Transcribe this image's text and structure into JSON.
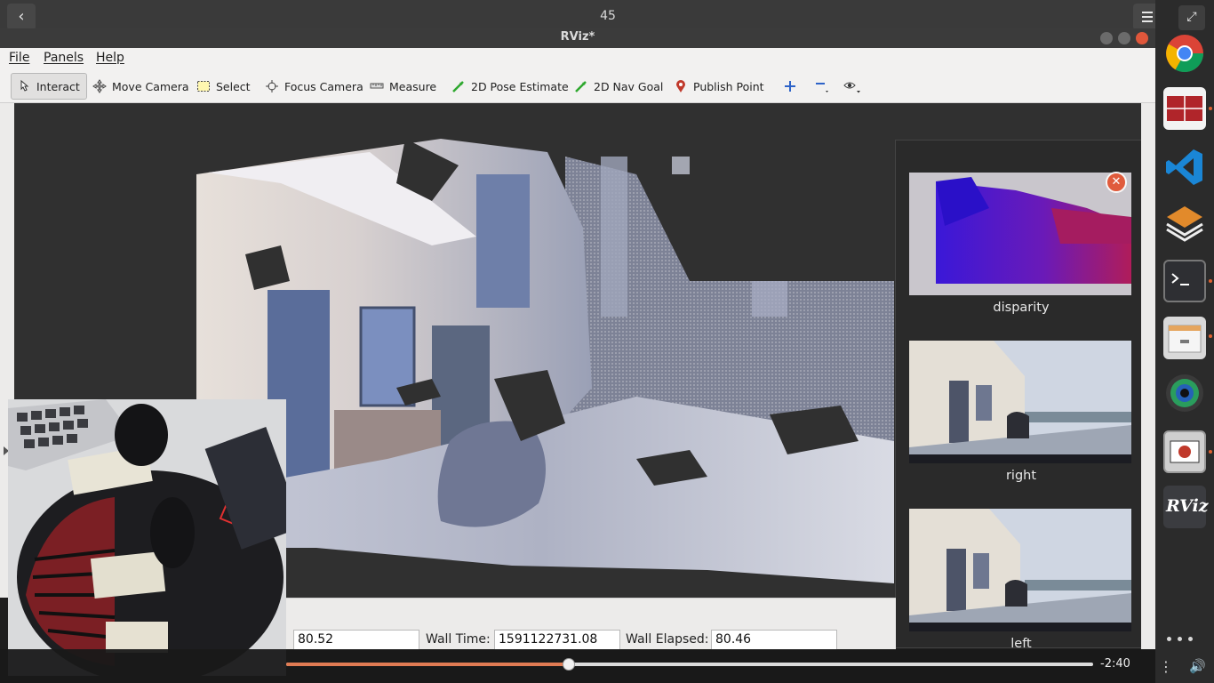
{
  "player": {
    "title": "45",
    "back_icon": "‹",
    "menu_icon": "hamburger-menu",
    "seek_fraction": 0.35,
    "time_remaining": "-2:40"
  },
  "rviz": {
    "window_title": "RViz*",
    "menu": [
      "File",
      "Panels",
      "Help"
    ],
    "tools": [
      {
        "label": "Interact",
        "icon": "cursor-icon"
      },
      {
        "label": "Move Camera",
        "icon": "move-camera-icon"
      },
      {
        "label": "Select",
        "icon": "select-icon"
      },
      {
        "label": "Focus Camera",
        "icon": "focus-camera-icon"
      },
      {
        "label": "Measure",
        "icon": "ruler-icon"
      },
      {
        "label": "2D Pose Estimate",
        "icon": "pose-estimate-icon"
      },
      {
        "label": "2D Nav Goal",
        "icon": "nav-goal-icon"
      },
      {
        "label": "Publish Point",
        "icon": "pin-icon"
      }
    ],
    "images": [
      {
        "caption": "disparity"
      },
      {
        "caption": "right"
      },
      {
        "caption": "left"
      }
    ],
    "time": {
      "ros_elapsed_value": "80.52",
      "wall_time_label": "Wall Time:",
      "wall_time_value": "1591122731.08",
      "wall_elapsed_label": "Wall Elapsed:",
      "wall_elapsed_value": "80.46"
    }
  },
  "dock": {
    "items": [
      "chrome",
      "app-red-grid",
      "vscode",
      "layers-app",
      "terminal",
      "file-manager",
      "camera-app",
      "recorder-app",
      "rviz"
    ],
    "rviz_label": "RViz"
  },
  "colors": {
    "accent": "#e07b53",
    "close": "#e05b3c"
  }
}
